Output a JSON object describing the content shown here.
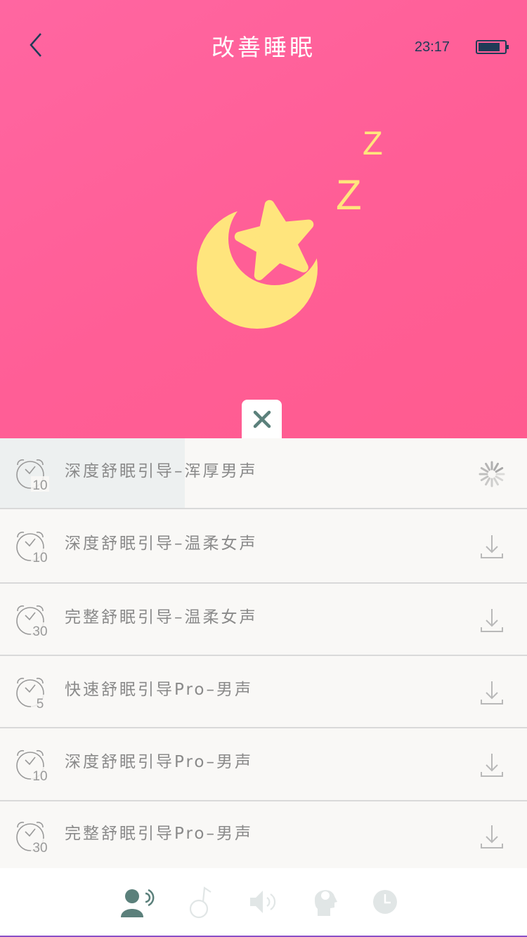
{
  "header": {
    "title": "改善睡眠",
    "time": "23:17"
  },
  "hero": {
    "z_large": "Z",
    "z_small": "Z"
  },
  "colors": {
    "hero_pink": "#ff5e96",
    "moon_yellow": "#ffe57d",
    "accent_teal": "#5b807b",
    "list_background": "#f9f8f6",
    "text_gray": "#8a8a8a"
  },
  "close_icon": "close-icon",
  "list": [
    {
      "timer": "10",
      "label": "深度舒眠引导–浑厚男声",
      "state": "downloading",
      "progress": 0.35
    },
    {
      "timer": "10",
      "label": "深度舒眠引导–温柔女声",
      "state": "download"
    },
    {
      "timer": "30",
      "label": "完整舒眠引导–温柔女声",
      "state": "download"
    },
    {
      "timer": "5",
      "label": "快速舒眠引导Pro–男声",
      "state": "download"
    },
    {
      "timer": "10",
      "label": "深度舒眠引导Pro–男声",
      "state": "download"
    },
    {
      "timer": "30",
      "label": "完整舒眠引导Pro–男声",
      "state": "download"
    }
  ],
  "bottom_nav": [
    {
      "icon": "voice-guide-icon",
      "active": true
    },
    {
      "icon": "music-note-icon",
      "active": false
    },
    {
      "icon": "speaker-icon",
      "active": false
    },
    {
      "icon": "head-icon",
      "active": false
    },
    {
      "icon": "clock-icon",
      "active": false
    }
  ]
}
